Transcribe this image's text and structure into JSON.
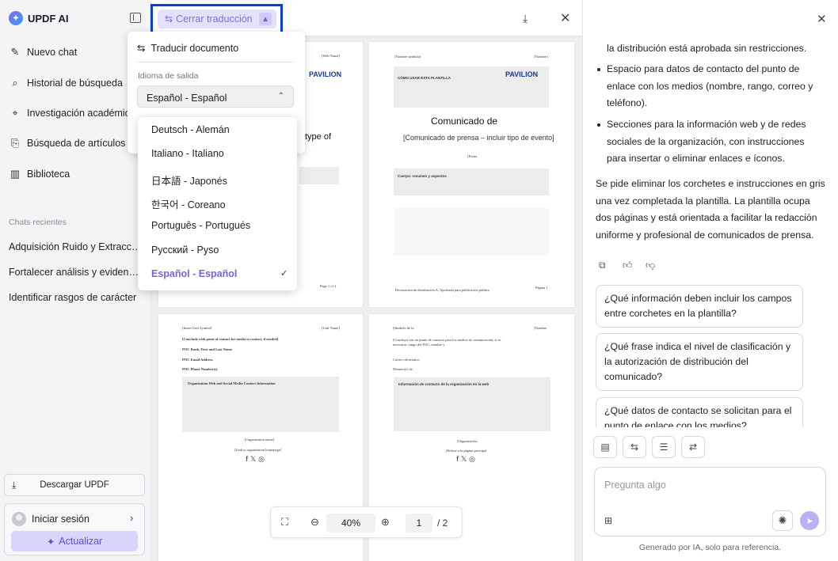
{
  "app": {
    "name": "UPDF AI"
  },
  "sidebar": {
    "items": [
      {
        "label": "Nuevo chat",
        "icon": "edit-icon"
      },
      {
        "label": "Historial de búsqueda",
        "icon": "search-icon"
      },
      {
        "label": "Investigación académica",
        "icon": "telescope-icon"
      },
      {
        "label": "Búsqueda de artículos",
        "icon": "doc-search-icon"
      },
      {
        "label": "Biblioteca",
        "icon": "library-icon"
      }
    ],
    "recent_title": "Chats recientes",
    "recent": [
      "Adquisición Ruido y Extracción",
      "Fortalecer análisis y evidencias",
      "Identificar rasgos de carácter"
    ],
    "download_label": "Descargar UPDF",
    "login_label": "Iniciar sesión",
    "upgrade_label": "Actualizar"
  },
  "toolbar": {
    "translate_close_label": "Cerrar traducción"
  },
  "translate_popup": {
    "translate_doc_label": "Traducir documento",
    "output_label": "Idioma de salida",
    "selected": "Español - Español",
    "options": [
      "Deutsch - Alemán",
      "Italiano - Italiano",
      "日本語 - Japonés",
      "한국어 - Coreano",
      "Português - Portugués",
      "Русский - Руso",
      "Español - Español"
    ]
  },
  "zoom": {
    "value": "40%",
    "page": "1",
    "total": "2"
  },
  "doc": {
    "p1": {
      "org": "[Web Name]",
      "pavilion": "PAVILION",
      "partial_heading": "type of",
      "page_num": "Page 1 of 2"
    },
    "p2": {
      "header_left": "[Nombre símbolo]",
      "header_right": "[Nombre]",
      "howto": "CÓMO USAR ESTA PLANTILLA",
      "pavilion": "PAVILION",
      "title": "Comunicado de",
      "subtitle": "[Comunicado de prensa – incluir tipo de evento]",
      "date": "[Fecha",
      "body_head": "Cuerpo: resumen y aspectos",
      "footer": "Declaración de distribución A: Aprobada para publicación pública",
      "page_num": "Página 1"
    },
    "p3": {
      "header_left": "[Insert Unit Symbol]",
      "header_right": "[Unit Name]",
      "l1": "[Conclude with point of contact for media to contact, if needed]",
      "l2": "POC Rank, First and Last Name",
      "l3": "POC Email Address",
      "l4": "POC Phone Number(s)",
      "box_title": "Organization Web and Social Media Contact Information",
      "org": "[Organization name]",
      "link": "[Link to organization homepage]"
    },
    "p4": {
      "header_left": "[Símbolo de la",
      "header_right": "[Nombre",
      "l1": "[Concluya con un punto de contacto para los medios de comunicación, si es necesario: rango del POC, nombre y",
      "l2": "Correo electrónico",
      "l3": "Número(s) de",
      "box_title": "Información de contacto de la organización en la web",
      "org": "[Organización",
      "link": "[Enlace a la página principal"
    }
  },
  "ai": {
    "t1": "la distribución está aprobada sin restricciones.",
    "b1": "Espacio para datos de contacto del punto de enlace con los medios (nombre, rango, correo y teléfono).",
    "b2": "Secciones para la información web y de redes sociales de la organización, con instrucciones para insertar o eliminar enlaces e íconos.",
    "p": "Se pide eliminar los corchetes e instrucciones en gris una vez completada la plantilla. La plantilla ocupa dos páginas y está orientada a facilitar la redacción uniforme y profesional de comunicados de prensa.",
    "suggestions": [
      "¿Qué información deben incluir los campos entre corchetes en la plantilla?",
      "¿Qué frase indica el nivel de clasificación y la autorización de distribución del comunicado?",
      "¿Qué datos de contacto se solicitan para el punto de enlace con los medios?"
    ],
    "input_placeholder": "Pregunta algo",
    "footnote": "Generado por IA, solo para referencia."
  },
  "colors": {
    "accent": "#6a5fe0",
    "highlight": "#0a3fd6"
  }
}
